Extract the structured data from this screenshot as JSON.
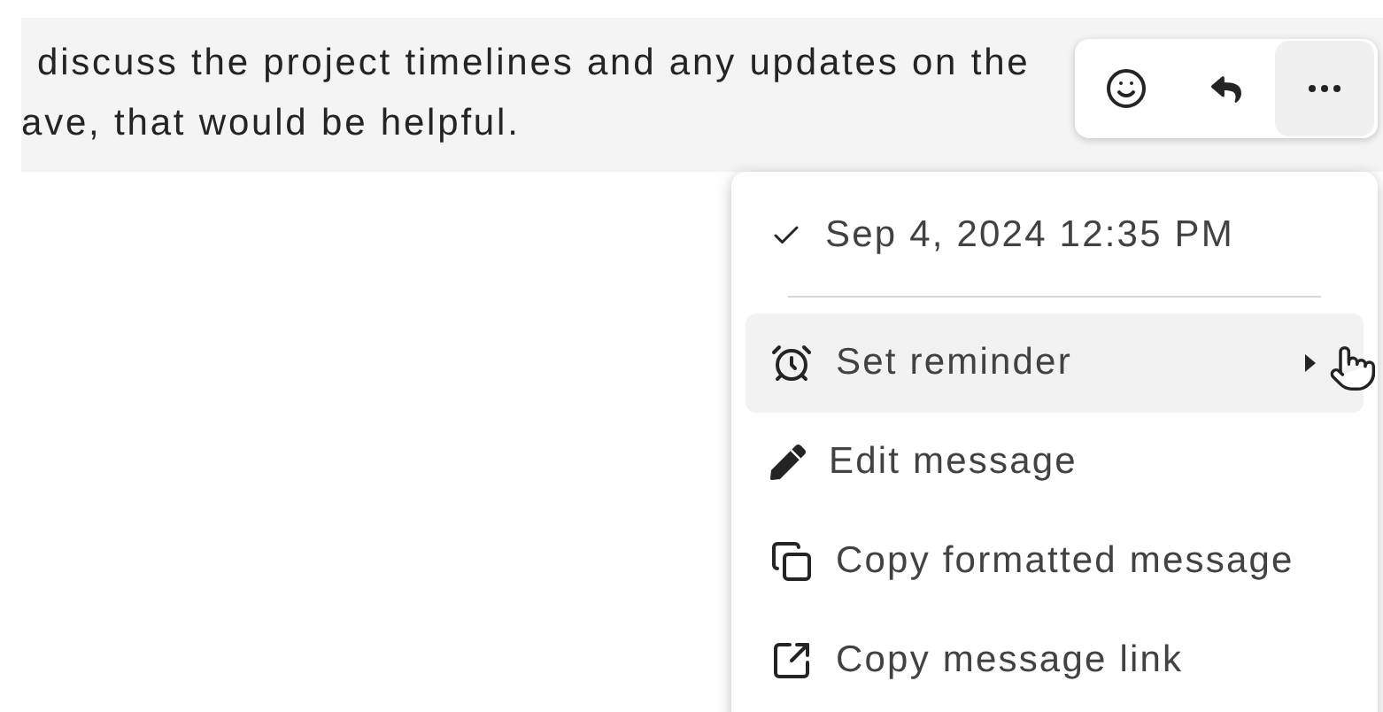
{
  "message": {
    "lines": [
      "discuss the project timelines and any updates on the",
      "ave, that would be helpful."
    ]
  },
  "toolbar": {
    "buttons": [
      {
        "selected": false
      },
      {
        "selected": false
      },
      {
        "selected": true
      }
    ]
  },
  "menu": {
    "timestamp": {
      "text": "Sep 4, 2024 12:35 PM",
      "checked": true
    },
    "items": [
      {
        "label": "Set reminder",
        "selected": true,
        "submenu": true
      },
      {
        "label": "Edit message",
        "selected": false,
        "submenu": false
      },
      {
        "label": "Copy formatted message",
        "selected": false,
        "submenu": false
      },
      {
        "label": "Copy message link",
        "selected": false,
        "submenu": false
      }
    ]
  }
}
